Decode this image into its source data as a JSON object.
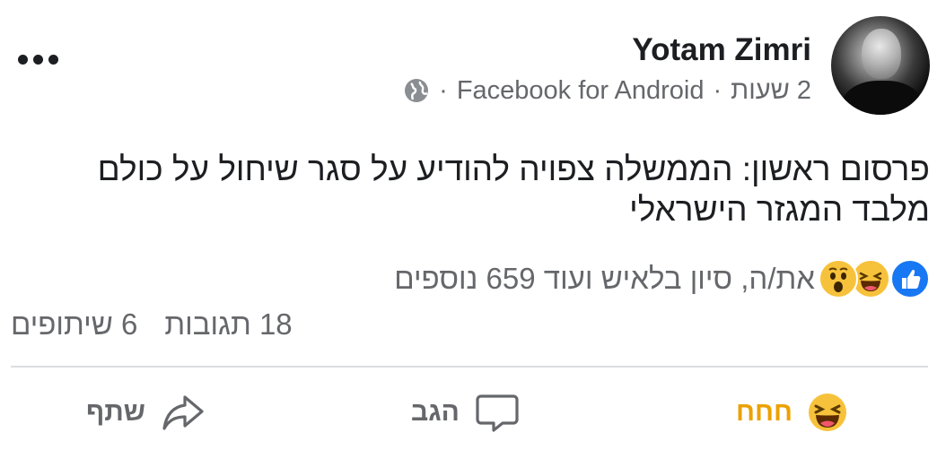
{
  "post": {
    "author": "Yotam Zimri",
    "time": "2 שעות",
    "separator": "·",
    "source": "Facebook for Android",
    "text": "פרסום ראשון: הממשלה צפויה להודיע על סגר שיחול על כולם מלבד המגזר הישראלי"
  },
  "reactions": {
    "summary": "את/ה, סיון בלאיש ועוד 659 נוספים",
    "icons": [
      "like-icon",
      "haha-icon",
      "wow-icon"
    ]
  },
  "counts": {
    "comments": "18 תגובות",
    "shares": "6 שיתופים"
  },
  "actions": {
    "reaction_label": "חחח",
    "comment_label": "הגב",
    "share_label": "שתף"
  },
  "colors": {
    "text": "#1c1e21",
    "secondary": "#65676b",
    "like_blue": "#1877f2",
    "haha_active": "#eba100",
    "divider": "#dadde1"
  }
}
